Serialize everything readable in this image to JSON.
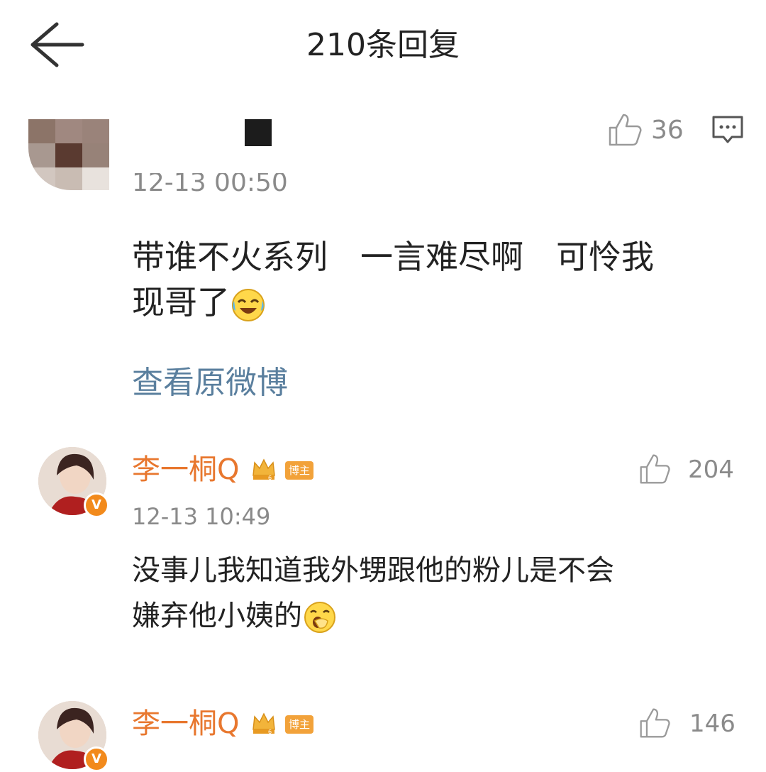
{
  "header": {
    "title": "210条回复"
  },
  "main_comment": {
    "timestamp": "12-13 00:50",
    "like_count": "36",
    "text_lines": [
      "带谁不火系列　一言难尽啊　可怜我",
      "现哥了"
    ],
    "view_original": "查看原微博"
  },
  "replies": [
    {
      "username": "李一桐Q",
      "badge_label": "博主",
      "crown_level": "6",
      "verified_mark": "V",
      "timestamp": "12-13 10:49",
      "like_count": "204",
      "text_lines": [
        "没事儿我知道我外甥跟他的粉儿是不会",
        "嫌弃他小姨的"
      ]
    },
    {
      "username": "李一桐Q",
      "badge_label": "博主",
      "crown_level": "6",
      "verified_mark": "V",
      "like_count": "146"
    }
  ],
  "colors": {
    "username": "#e8772e",
    "link": "#5a7f9e",
    "secondary_text": "#8a8a8a",
    "badge": "#f2a23a"
  }
}
